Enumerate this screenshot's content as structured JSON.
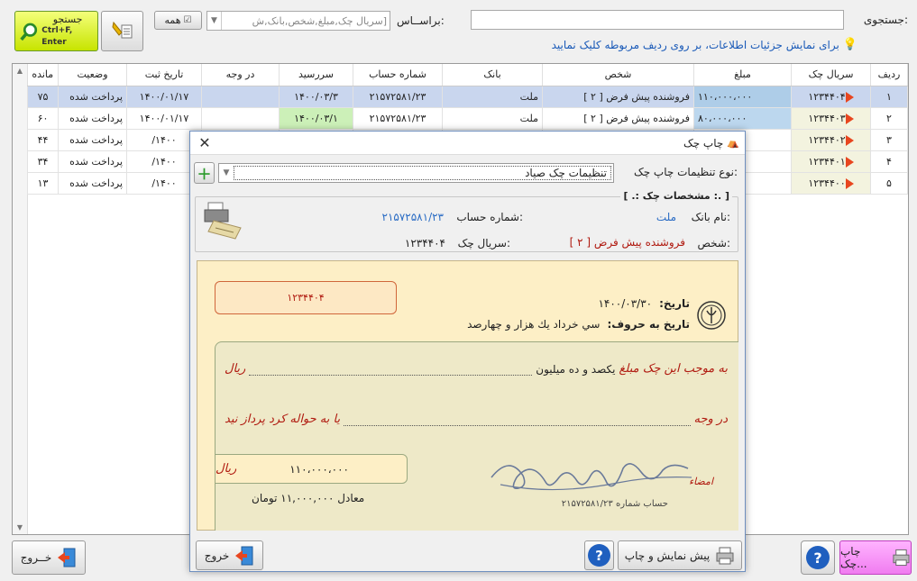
{
  "search": {
    "label": "جستجوی:",
    "value": "",
    "hint": "برای نمایش جزئیات اطلاعات، بر روی ردیف مربوطه کلیک نمایید",
    "based_on_label": "براســاس:",
    "based_on_value": "[سریال چک,مبلغ,شخص,بانک,ش",
    "all_label": "همه",
    "search_btn": "جستجو",
    "search_shortcut": "Ctrl+F, Enter"
  },
  "table": {
    "headers": [
      "ردیف",
      "سریال چک",
      "مبلغ",
      "شخص",
      "بانک",
      "شماره حساب",
      "سررسید",
      "در وجه",
      "تاریخ ثبت",
      "وضعیت",
      "مانده"
    ],
    "rows": [
      [
        "۱",
        "۱۲۳۴۴۰۴",
        "۱۱۰،۰۰۰،۰۰۰",
        "فروشنده پیش فرض [ ۲ ]",
        "ملت",
        "۲۱۵۷۲۵۸۱/۲۳",
        "۱۴۰۰/۰۳/۳",
        "",
        "۱۴۰۰/۰۱/۱۷",
        "پرداخت شده",
        "۷۵"
      ],
      [
        "۲",
        "۱۲۳۴۴۰۳",
        "۸۰،۰۰۰،۰۰۰",
        "فروشنده پیش فرض [ ۲ ]",
        "ملت",
        "۲۱۵۷۲۵۸۱/۲۳",
        "۱۴۰۰/۰۳/۱",
        "",
        "۱۴۰۰/۰۱/۱۷",
        "پرداخت شده",
        "۶۰"
      ],
      [
        "۳",
        "۱۲۳۴۴۰۲",
        "",
        "",
        "",
        "",
        "",
        "",
        "۱۴۰۰/",
        "پرداخت شده",
        "۴۴"
      ],
      [
        "۴",
        "۱۲۳۴۴۰۱",
        "",
        "",
        "",
        "",
        "",
        "",
        "۱۴۰۰/",
        "پرداخت شده",
        "۳۴"
      ],
      [
        "۵",
        "۱۲۳۴۴۰۰",
        "",
        "",
        "",
        "",
        "",
        "",
        "۱۴۰۰/",
        "پرداخت شده",
        "۱۳"
      ]
    ]
  },
  "footer": {
    "print_btn": "چاپ چک...",
    "exit_btn": "خــروج"
  },
  "dialog": {
    "title": "چاپ چک",
    "settings_label": "نوع تنظیمات چاپ چک:",
    "settings_value": "تنظیمات چک صیاد",
    "group_title": "[ .: مشخصات چک :. ]",
    "bank_label": "نام بانک:",
    "bank_value": "ملت",
    "account_label": "شماره حساب:",
    "account_value": "۲۱۵۷۲۵۸۱/۲۳",
    "person_label": "شخص:",
    "person_value": "فروشنده پیش فرض [ ۲ ]",
    "serial_label": "سریال چک:",
    "serial_value": "۱۲۳۴۴۰۴",
    "preview_btn": "پیش نمایش و چاپ",
    "exit_btn": "خروج"
  },
  "cheque": {
    "serial": "۱۲۳۴۴۰۴",
    "date_label": "تاریخ:",
    "date_value": "۱۴۰۰/۰۳/۳۰",
    "date_words_label": "تاریخ به حروف:",
    "date_words_value": "سي    خرداد يك هزار و چهارصد",
    "amount_prefix": "به موجب این چک مبلغ",
    "amount_words": "یکصد و ده میلیون",
    "rial": "ریال",
    "payee_prefix": "در وجه",
    "payee_suffix": "یا به حواله کرد پرداز نید",
    "amount_num": "۱۱۰،۰۰۰،۰۰۰",
    "rial2": "ریال",
    "equiv": "معادل ۱۱,۰۰۰,۰۰۰ تومان",
    "signature_label": "امضاء",
    "account_line": "حساب شماره ۲۱۵۷۲۵۸۱/۲۳"
  }
}
